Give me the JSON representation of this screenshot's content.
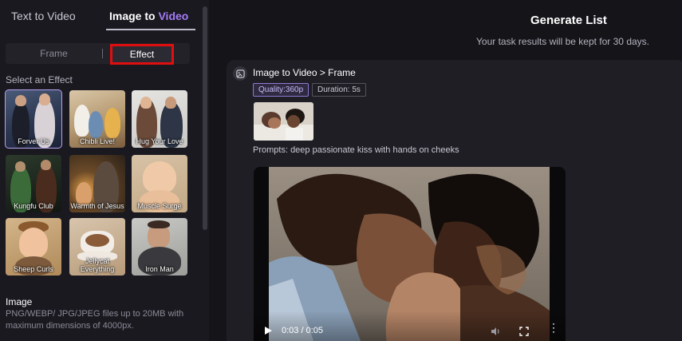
{
  "tabs": {
    "text_to_video": "Text to Video",
    "image_to": "Image to",
    "video": "Video"
  },
  "mode": {
    "frame": "Frame",
    "effect": "Effect"
  },
  "effects": {
    "label": "Select an Effect",
    "items": [
      {
        "name": "Forver Us",
        "selected": true
      },
      {
        "name": "Chibli Live!"
      },
      {
        "name": "Hug Your Love"
      },
      {
        "name": "Kungfu Club"
      },
      {
        "name": "Warmth of Jesus"
      },
      {
        "name": "Muscle Surge"
      },
      {
        "name": "Sheep Curls"
      },
      {
        "name": "Jellycat Everything"
      },
      {
        "name": "Iron Man"
      }
    ]
  },
  "image": {
    "label": "Image",
    "description": "PNG/WEBP/ JPG/JPEG files up to 20MB with maximum dimensions of 4000px."
  },
  "generate": {
    "title": "Generate List",
    "subtitle": "Your task results will be kept for 30 days."
  },
  "task": {
    "title": "Image to Video > Frame",
    "quality": "Quality:360p",
    "duration": "Duration: 5s",
    "prompts": "Prompts:  deep passionate kiss with hands on cheeks",
    "video": {
      "time": "0:03 / 0:05",
      "progress": 0.72
    }
  },
  "colors": {
    "accent": "#a57cf7",
    "highlight_border": "#e00f0f"
  }
}
